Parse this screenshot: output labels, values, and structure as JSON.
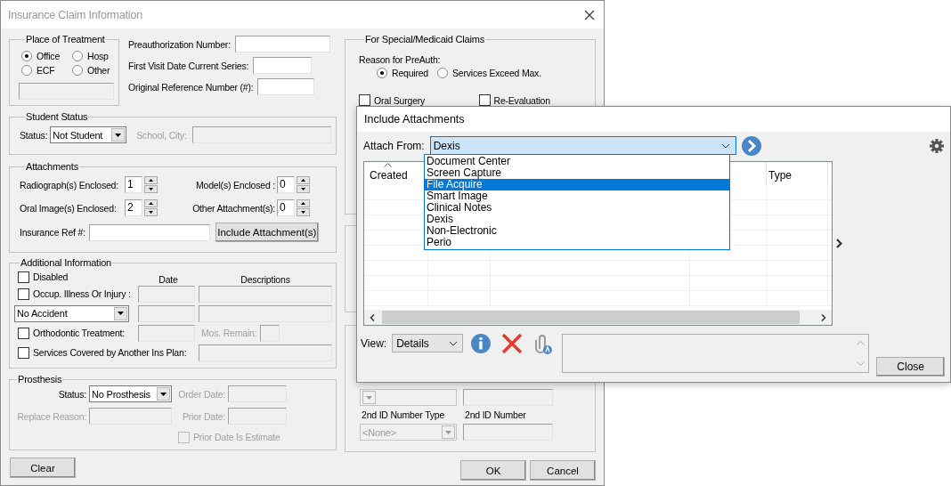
{
  "window": {
    "title": "Insurance Claim Information"
  },
  "place_of_treatment": {
    "title": "Place of Treatment",
    "options": [
      {
        "label": "Office",
        "selected": true
      },
      {
        "label": "Hosp",
        "selected": false
      },
      {
        "label": "ECF",
        "selected": false
      },
      {
        "label": "Other",
        "selected": false
      }
    ],
    "other_field_disabled": true
  },
  "preauth_fields": [
    {
      "label": "Preauthorization Number:"
    },
    {
      "label": "First Visit Date Current Series:"
    },
    {
      "label": "Original Reference Number (#):"
    }
  ],
  "student_status": {
    "title": "Student Status",
    "status_label": "Status:",
    "status": "Not Student",
    "school_label": "School, City:",
    "school_disabled": true
  },
  "attachments": {
    "title": "Attachments",
    "counts": [
      {
        "label": "Radiograph(s) Enclosed:",
        "value": "1"
      },
      {
        "label": "Model(s) Enclosed :",
        "value": "0"
      },
      {
        "label": "Oral Image(s) Enclosed:",
        "value": "2"
      },
      {
        "label": "Other Attachment(s):",
        "value": "0"
      }
    ],
    "ref_label": "Insurance Ref #:",
    "include_button": "Include Attachment(s)"
  },
  "additional_information": {
    "title": "Additional Information",
    "date_heading": "Date",
    "descriptions_heading": "Descriptions",
    "disabled_check": {
      "label": "Disabled",
      "checked": false
    },
    "occupational": {
      "label": "Occup. Illness Or Injury :",
      "checked": false
    },
    "accident": "No Accident",
    "orthodontic": {
      "label": "Orthodontic Treatment:",
      "checked": false
    },
    "months_remaining_label": "Mos. Remain:",
    "other_plan": {
      "label": "Services Covered by Another Ins Plan:",
      "checked": false
    },
    "fields_disabled": true
  },
  "prosthesis": {
    "title": "Prosthesis",
    "status_label": "Status:",
    "status": "No Prosthesis",
    "order_date_label": "Order Date:",
    "replace_reason_label": "Replace Reason:",
    "prior_date_label": "Prior Date:",
    "prior_date_estimate": {
      "label": "Prior Date Is Estimate",
      "checked": false
    },
    "disabled": true
  },
  "special_claims": {
    "title": "For Special/Medicaid Claims",
    "reason_label": "Reason for PreAuth:",
    "reasons": [
      {
        "label": "Required",
        "selected": true
      },
      {
        "label": "Services Exceed Max.",
        "selected": false
      }
    ],
    "checks": [
      {
        "label": "Oral Surgery",
        "checked": false
      },
      {
        "label": "Re-Evaluation",
        "checked": false
      }
    ]
  },
  "id_numbers": {
    "second_type_label": "2nd ID Number Type",
    "second_type": "<None>",
    "second_number_label": "2nd ID Number",
    "disabled": true
  },
  "buttons": {
    "clear": "Clear",
    "ok": "OK",
    "cancel": "Cancel"
  },
  "attach_dialog": {
    "title": "Include Attachments",
    "attach_from_label": "Attach From:",
    "source": "Dexis",
    "sources": [
      {
        "label": "Document Center",
        "selected": false
      },
      {
        "label": "Screen Capture",
        "selected": false
      },
      {
        "label": "File Acquire",
        "selected": true
      },
      {
        "label": "Smart Image",
        "selected": false
      },
      {
        "label": "Clinical Notes",
        "selected": false
      },
      {
        "label": "Dexis",
        "selected": false
      },
      {
        "label": "Non-Electronic",
        "selected": false
      },
      {
        "label": "Perio",
        "selected": false
      }
    ],
    "columns": [
      "Created",
      "Type"
    ],
    "view_label": "View:",
    "view": "Details",
    "close_button": "Close"
  }
}
